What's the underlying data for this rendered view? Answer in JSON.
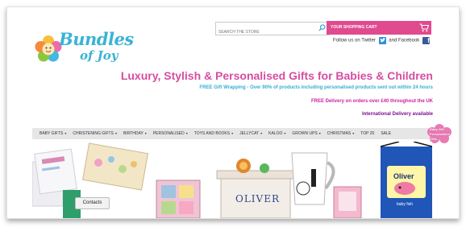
{
  "logo": {
    "line1": "Bundles",
    "line2": "of Joy"
  },
  "search": {
    "placeholder": "SEARCH THE STORE"
  },
  "cart": {
    "label": "YOUR SHOPPING CART"
  },
  "social": {
    "text_prefix": "Follow us on Twitter",
    "text_mid": "and Facebook"
  },
  "tagline": "Luxury, Stylish & Personalised Gifts for Babies & Children",
  "promos": [
    "FREE Gift Wrapping - Over 90% of products including personalised products sent out within 24 hours",
    "FREE Delivery on orders over £40 throughout the UK",
    "International Delivery available"
  ],
  "nav": [
    "BABY GIFTS",
    "CHRISTENING GIFTS",
    "BIRTHDAY",
    "PERSONALISED",
    "TOYS AND BOOKS",
    "JELLYCAT",
    "KALOO",
    "GROWN UPS",
    "CHRISTMAS",
    "TOP 20",
    "SALE"
  ],
  "nav_arrow": "▾",
  "badge_lines": [
    "Baby Gift",
    "Personalised",
    "Gifts"
  ],
  "products": {
    "box_name": "OLIVER",
    "bag_name": "Oliver",
    "bag_sub": "baby fish"
  },
  "contacts_label": "Contacts",
  "colors": {
    "brand_pink": "#e04a8e",
    "brand_blue": "#39b3d5",
    "nav_bg": "#e6e6e6"
  }
}
